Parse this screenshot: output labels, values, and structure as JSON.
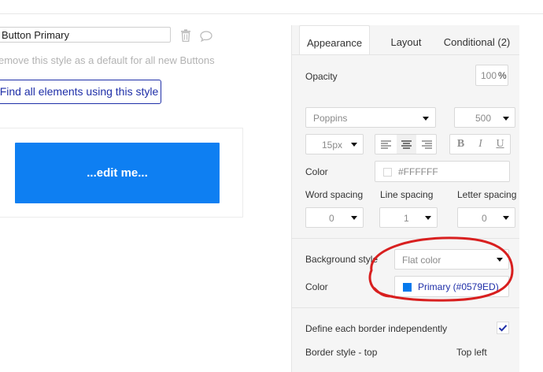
{
  "style_name": "Button Primary",
  "remove_text": "emove this style as a default for all new Buttons",
  "find_button": "Find all elements using this style",
  "preview_button": "...edit me...",
  "tabs": [
    {
      "label": "Appearance",
      "active": true
    },
    {
      "label": "Layout",
      "active": false
    },
    {
      "label": "Conditional (2)",
      "active": false
    }
  ],
  "opacity": {
    "label": "Opacity",
    "value": "100",
    "unit": "%"
  },
  "font": {
    "family": "Poppins",
    "weight": "500",
    "size": "15px"
  },
  "text_color": {
    "label": "Color",
    "value": "#FFFFFF"
  },
  "spacing": {
    "word_label": "Word spacing",
    "word_value": "0",
    "line_label": "Line spacing",
    "line_value": "1",
    "letter_label": "Letter spacing",
    "letter_value": "0"
  },
  "format_buttons": {
    "bold": "B",
    "italic": "I",
    "underline": "U"
  },
  "background": {
    "label": "Background style",
    "value": "Flat color"
  },
  "bg_color": {
    "label": "Color",
    "value": "Primary (#0579ED)",
    "swatch": "#0579ED"
  },
  "border": {
    "independent_label": "Define each border independently",
    "independent_checked": true,
    "style_top_label": "Border style - top",
    "top_left_label": "Top left"
  },
  "colors": {
    "accent": "#0579ED",
    "link": "#1f2fa8",
    "annotation": "#d81f1f"
  }
}
